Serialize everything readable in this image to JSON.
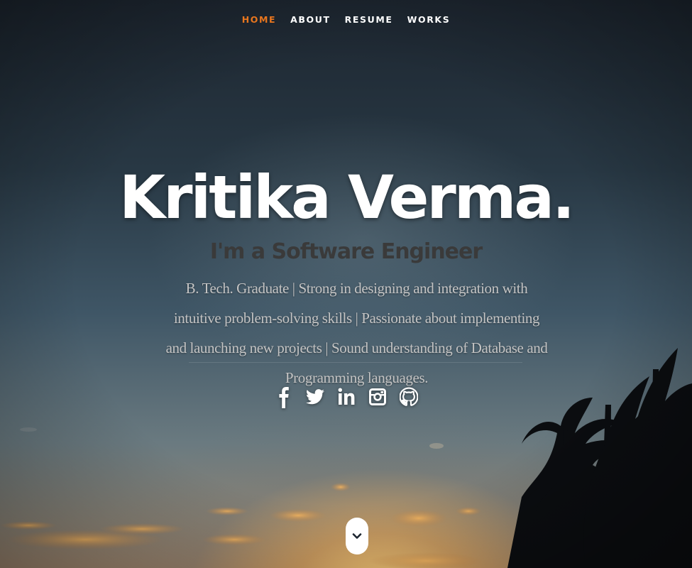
{
  "nav": {
    "items": [
      {
        "label": "HOME",
        "active": true
      },
      {
        "label": "ABOUT",
        "active": false
      },
      {
        "label": "RESUME",
        "active": false
      },
      {
        "label": "WORKS",
        "active": false
      }
    ],
    "active_color": "#e8761e"
  },
  "hero": {
    "title": "Kritika Verma.",
    "subtitle": "I'm a Software Engineer",
    "description": "B. Tech. Graduate | Strong in designing and integration with intuitive problem-solving skills | Passionate about implementing and launching new projects | Sound understanding of Database and Programming languages."
  },
  "socials": [
    {
      "icon": "facebook-icon"
    },
    {
      "icon": "twitter-icon"
    },
    {
      "icon": "linkedin-icon"
    },
    {
      "icon": "instagram-icon"
    },
    {
      "icon": "github-icon"
    }
  ],
  "scroll": {
    "icon": "chevron-down-icon"
  }
}
